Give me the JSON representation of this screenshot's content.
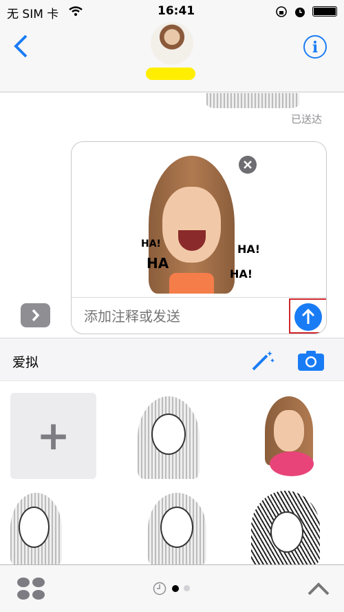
{
  "status_bar": {
    "carrier": "无 SIM 卡",
    "time": "16:41",
    "icons": [
      "wifi-icon",
      "orientation-lock-icon",
      "alarm-icon",
      "battery-icon"
    ]
  },
  "nav": {
    "back_icon": "chevron-left-icon",
    "info_icon": "info-icon"
  },
  "conversation": {
    "delivered": "已送达"
  },
  "compose": {
    "placeholder": "添加注释或发送",
    "sticker_text": [
      "HA!",
      "HA",
      "HA!",
      "HA!"
    ]
  },
  "app_drawer": {
    "title": "爱拟",
    "add_label": "+"
  },
  "bottom_bar": {
    "page_dots": 2,
    "active_dot": 0
  },
  "colors": {
    "accent": "#1a7cf5",
    "highlight": "#d0262b"
  }
}
